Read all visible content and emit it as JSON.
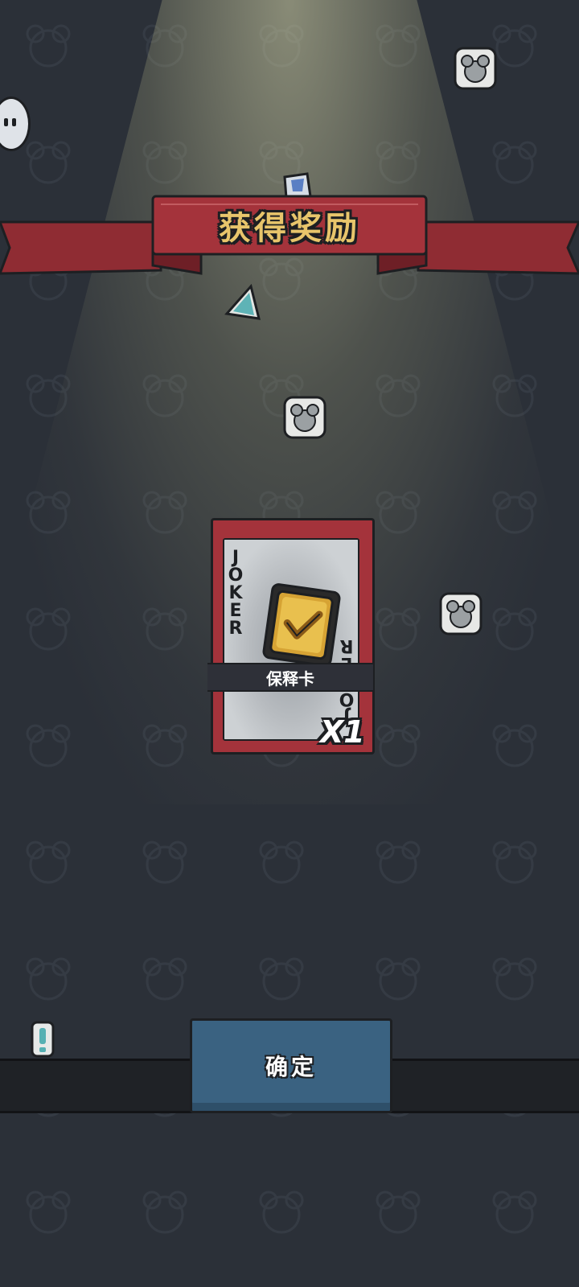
{
  "banner": {
    "title": "获得奖励"
  },
  "reward_card": {
    "corner_text": "JOKER",
    "icon": "golden-check-shield-icon",
    "name": "保释卡",
    "quantity": "X1"
  },
  "confirm_button": {
    "label": "确定"
  },
  "colors": {
    "background": "#2b3038",
    "ribbon": "#a4333b",
    "title_gold": "#e8c56b",
    "card_red": "#a4333b",
    "button_blue": "#3a6281"
  }
}
